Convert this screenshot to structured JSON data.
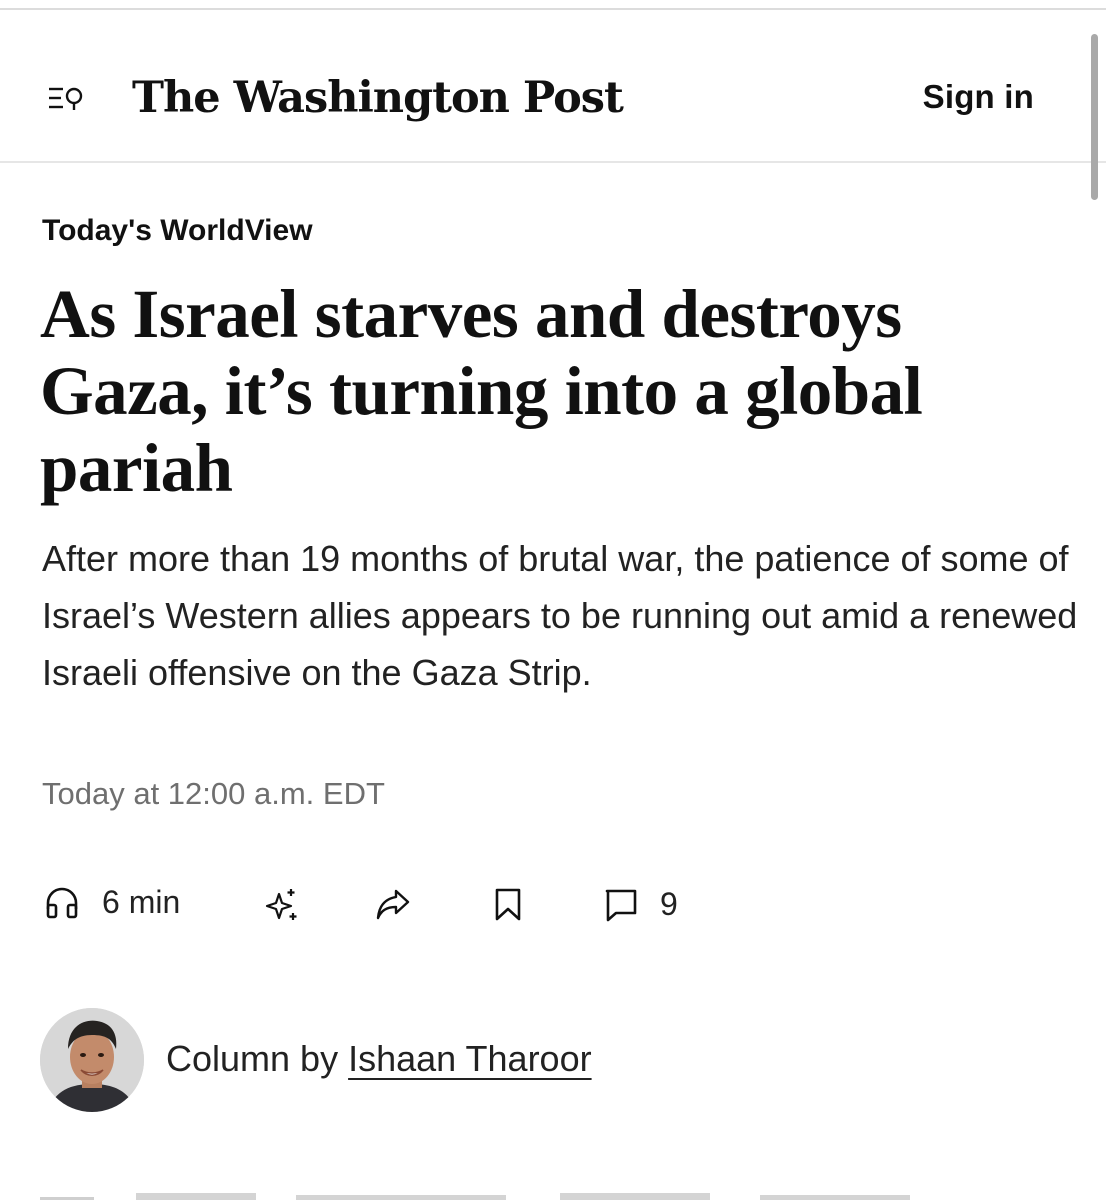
{
  "header": {
    "logo_text": "The Washington Post",
    "sign_in_label": "Sign in",
    "menu_icon": "menu-search-icon"
  },
  "article": {
    "kicker": "Today's WorldView",
    "headline": "As Israel starves and destroys Gaza, it’s turning into a global pariah",
    "dek": "After more than 19 months of brutal war, the patience of some of Israel’s Western allies appears to be running out amid a renewed Israeli offensive on the Gaza Strip.",
    "timestamp": "Today at 12:00 a.m. EDT"
  },
  "toolbar": {
    "listen_label": "6 min",
    "listen_icon": "headphones-icon",
    "summary_icon": "sparkles-icon",
    "share_icon": "share-arrow-icon",
    "save_icon": "bookmark-icon",
    "comments_icon": "comment-icon",
    "comments_count": "9"
  },
  "byline": {
    "prefix": "Column by",
    "author": "Ishaan Tharoor"
  },
  "colors": {
    "text": "#111111",
    "muted": "#6f6f6f",
    "divider": "#e6e6e6",
    "scrollbar": "#a9a9a9"
  }
}
